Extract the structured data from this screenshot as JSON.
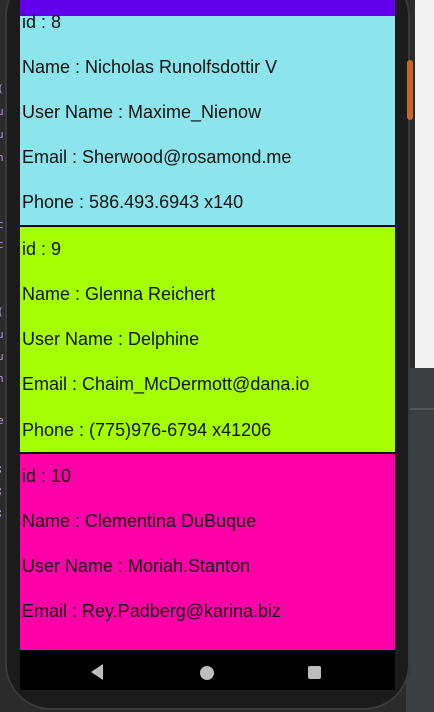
{
  "app": {
    "status_bar_color": "#6200ee"
  },
  "users": [
    {
      "id_text": "id : 8",
      "name_text": "Name : Nicholas Runolfsdottir V",
      "username_text": "User Name : Maxime_Nienow",
      "email_text": "Email : Sherwood@rosamond.me",
      "phone_text": "Phone : 586.493.6943 x140",
      "color": "#8ce4ec"
    },
    {
      "id_text": "id : 9",
      "name_text": "Name : Glenna Reichert",
      "username_text": "User Name : Delphine",
      "email_text": "Email : Chaim_McDermott@dana.io",
      "phone_text": "Phone : (775)976-6794 x41206",
      "color": "#a4ff00"
    },
    {
      "id_text": "id : 10",
      "name_text": "Name : Clementina DuBuque",
      "username_text": "User Name : Moriah.Stanton",
      "email_text": "Email : Rey.Padberg@karina.biz",
      "phone_text": "",
      "color": "#ff00a8"
    }
  ],
  "nav": {
    "back_icon": "triangle-back-icon",
    "home_icon": "circle-home-icon",
    "recents_icon": "square-recents-icon"
  }
}
